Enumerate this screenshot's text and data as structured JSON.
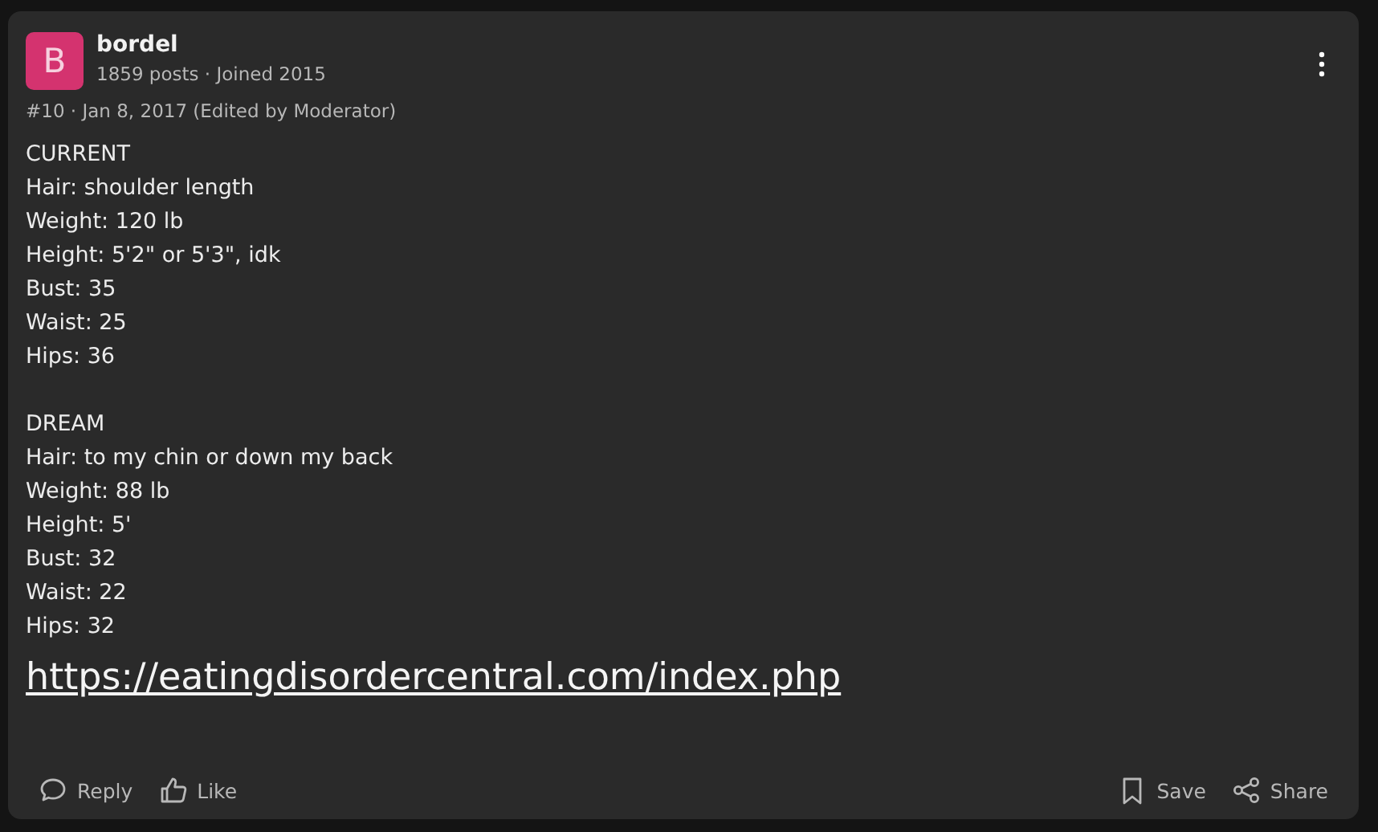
{
  "post": {
    "avatar_letter": "B",
    "author": "bordel",
    "author_meta": "1859 posts · Joined 2015",
    "post_meta": "#10 · Jan 8, 2017 (Edited by Moderator)",
    "body": [
      {
        "lines": [
          "CURRENT",
          "Hair: shoulder length",
          "Weight: 120 lb",
          "Height: 5'2\" or 5'3\", idk",
          "Bust: 35",
          "Waist: 25",
          "Hips: 36"
        ]
      },
      {
        "lines": [
          "DREAM",
          "Hair: to my chin or down my back",
          "Weight: 88 lb",
          "Height: 5'",
          "Bust: 32",
          "Waist: 22",
          "Hips: 32"
        ]
      }
    ],
    "link": "https://eatingdisordercentral.com/index.php",
    "actions_left": [
      {
        "kind": "reply",
        "label": "Reply"
      },
      {
        "kind": "like",
        "label": "Like"
      }
    ],
    "actions_right": [
      {
        "kind": "save",
        "label": "Save"
      },
      {
        "kind": "share",
        "label": "Share"
      }
    ]
  }
}
